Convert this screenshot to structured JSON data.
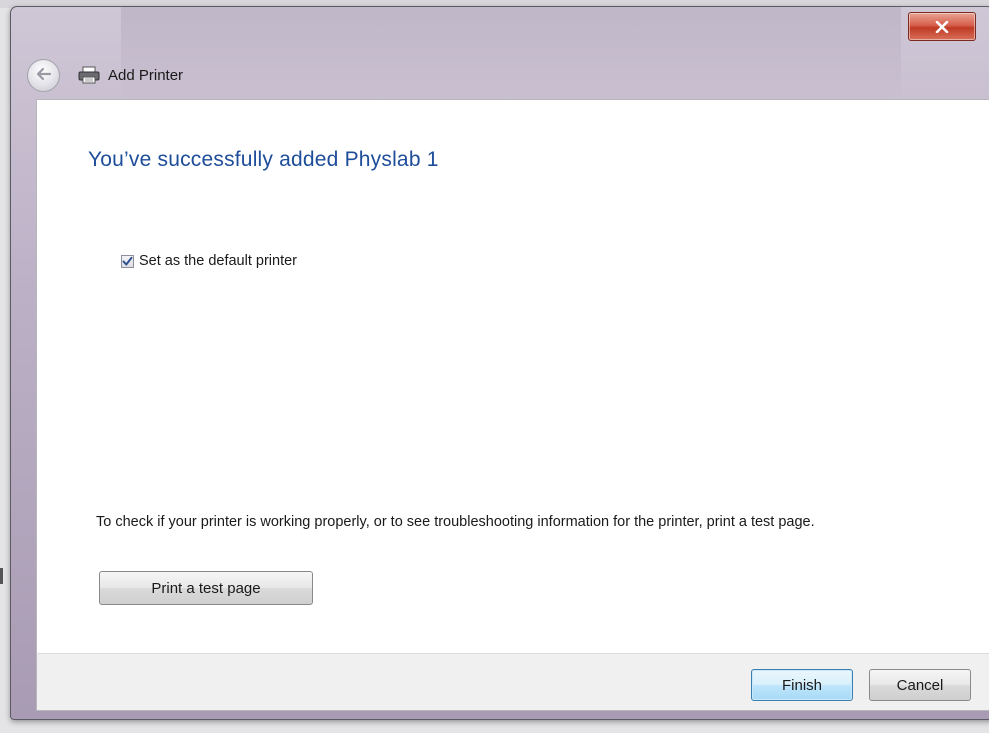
{
  "window": {
    "title": "Add Printer",
    "close_icon": "close-icon",
    "back_icon": "back-arrow-icon",
    "title_icon": "printer-icon"
  },
  "main": {
    "heading": "You’ve successfully added Physlab 1",
    "default_printer_checkbox": {
      "label": "Set as the default printer",
      "checked": true
    },
    "info_text": "To check if your printer is working properly, or to see troubleshooting information for the printer, print a test page.",
    "test_page_button": "Print a test page"
  },
  "footer": {
    "finish_label": "Finish",
    "cancel_label": "Cancel"
  },
  "colors": {
    "heading": "#1e4d9a",
    "close_button": "#c03a24",
    "default_button_border": "#3c7fb1"
  }
}
